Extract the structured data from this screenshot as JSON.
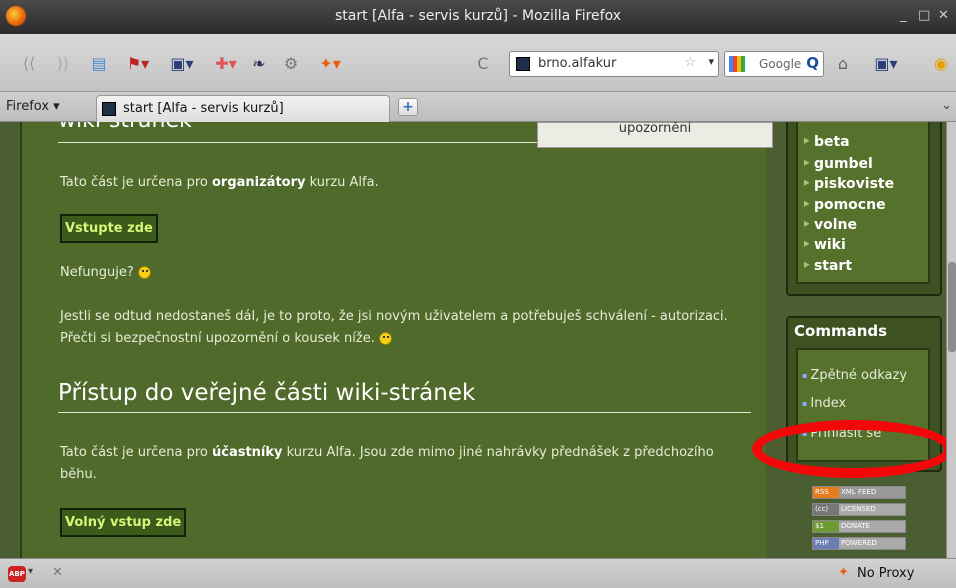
{
  "window": {
    "title": "start [Alfa - servis kurzů] - Mozilla Firefox",
    "minimize": "_",
    "maximize": "□",
    "close": "✕"
  },
  "nav": {
    "back": "⟨⟨",
    "forward": "⟩⟩",
    "reload": "C",
    "url": "brno.alfakur",
    "search_engine": "Google",
    "icons": [
      "back-icon",
      "forward-icon",
      "bookmarks-icon",
      "extension-icon",
      "save-icon",
      "new-tab-icon",
      "gear-icon",
      "rocket-icon",
      "reload-icon",
      "home-icon",
      "reader-icon",
      "addon-icon"
    ]
  },
  "tabs": {
    "menu_label": "Firefox",
    "active_tab": "start [Alfa - servis kurzů]",
    "new_tab": "+"
  },
  "page": {
    "prev_heading": "wiki-stránek",
    "notice": "upozornění",
    "para1_prefix": "Tato část je určena pro ",
    "para1_bold": "organizátory",
    "para1_suffix": " kurzu Alfa.",
    "btn_enter": "Vstupte zde",
    "not_working": "Nefunguje?",
    "para2": "Jestli se odtud nedostaneš dál, je to proto, že jsi novým uživatelem a potřebuješ schválení - autorizaci. Přečti si bezpečnostní upozornění o kousek níže.",
    "h2": "Přístup do veřejné části wiki-stránek",
    "para3_prefix": "Tato část je určena pro ",
    "para3_bold": "účastníky",
    "para3_suffix": " kurzu Alfa. Jsou zde mimo jiné nahrávky přednášek z předchozího běhu.",
    "btn_free": "Volný vstup zde"
  },
  "sidebar": {
    "namespaces": [
      "beta",
      "gumbel",
      "piskoviste",
      "pomocne",
      "volne",
      "wiki",
      "start"
    ],
    "commands_title": "Commands",
    "commands": [
      "Zpětné odkazy",
      "Index",
      "Přihlásit se"
    ],
    "badges": [
      {
        "a": "RSS",
        "b": "XML FEED",
        "ca": "#e87b1e",
        "cb": "#999"
      },
      {
        "a": "(cc)",
        "b": "LICENSED",
        "ca": "#777",
        "cb": "#aaa"
      },
      {
        "a": "$1",
        "b": "DONATE",
        "ca": "#6b9b32",
        "cb": "#aaa"
      },
      {
        "a": "PHP",
        "b": "POWERED",
        "ca": "#6b7fb3",
        "cb": "#aaa"
      }
    ]
  },
  "status": {
    "abp": "ABP",
    "close": "✕",
    "proxy": "No Proxy"
  },
  "colors": {
    "page_bg": "#4f6a2a",
    "highlight": "#f20808"
  }
}
